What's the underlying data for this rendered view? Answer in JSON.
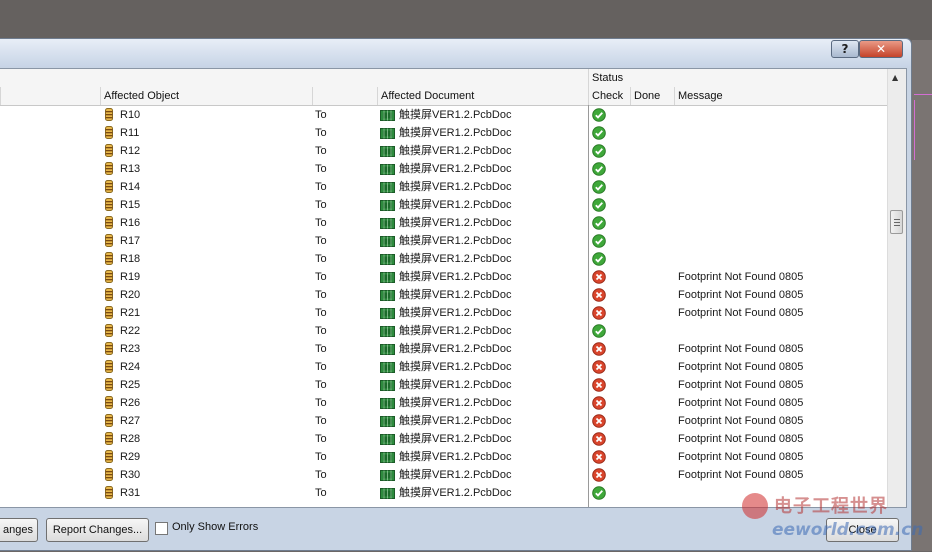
{
  "window": {
    "help_label": "?",
    "close_label": "✕"
  },
  "columns": {
    "status_group": "Status",
    "affected_object": "Affected Object",
    "affected_document": "Affected Document",
    "check": "Check",
    "done": "Done",
    "message": "Message"
  },
  "rows": [
    {
      "object": "R10",
      "to": "To",
      "document": "触摸屏VER1.2.PcbDoc",
      "check": "ok",
      "message": ""
    },
    {
      "object": "R11",
      "to": "To",
      "document": "触摸屏VER1.2.PcbDoc",
      "check": "ok",
      "message": ""
    },
    {
      "object": "R12",
      "to": "To",
      "document": "触摸屏VER1.2.PcbDoc",
      "check": "ok",
      "message": ""
    },
    {
      "object": "R13",
      "to": "To",
      "document": "触摸屏VER1.2.PcbDoc",
      "check": "ok",
      "message": ""
    },
    {
      "object": "R14",
      "to": "To",
      "document": "触摸屏VER1.2.PcbDoc",
      "check": "ok",
      "message": ""
    },
    {
      "object": "R15",
      "to": "To",
      "document": "触摸屏VER1.2.PcbDoc",
      "check": "ok",
      "message": ""
    },
    {
      "object": "R16",
      "to": "To",
      "document": "触摸屏VER1.2.PcbDoc",
      "check": "ok",
      "message": ""
    },
    {
      "object": "R17",
      "to": "To",
      "document": "触摸屏VER1.2.PcbDoc",
      "check": "ok",
      "message": ""
    },
    {
      "object": "R18",
      "to": "To",
      "document": "触摸屏VER1.2.PcbDoc",
      "check": "ok",
      "message": ""
    },
    {
      "object": "R19",
      "to": "To",
      "document": "触摸屏VER1.2.PcbDoc",
      "check": "error",
      "message": "Footprint Not Found 0805"
    },
    {
      "object": "R20",
      "to": "To",
      "document": "触摸屏VER1.2.PcbDoc",
      "check": "error",
      "message": "Footprint Not Found 0805"
    },
    {
      "object": "R21",
      "to": "To",
      "document": "触摸屏VER1.2.PcbDoc",
      "check": "error",
      "message": "Footprint Not Found 0805"
    },
    {
      "object": "R22",
      "to": "To",
      "document": "触摸屏VER1.2.PcbDoc",
      "check": "ok",
      "message": ""
    },
    {
      "object": "R23",
      "to": "To",
      "document": "触摸屏VER1.2.PcbDoc",
      "check": "error",
      "message": "Footprint Not Found 0805"
    },
    {
      "object": "R24",
      "to": "To",
      "document": "触摸屏VER1.2.PcbDoc",
      "check": "error",
      "message": "Footprint Not Found 0805"
    },
    {
      "object": "R25",
      "to": "To",
      "document": "触摸屏VER1.2.PcbDoc",
      "check": "error",
      "message": "Footprint Not Found 0805"
    },
    {
      "object": "R26",
      "to": "To",
      "document": "触摸屏VER1.2.PcbDoc",
      "check": "error",
      "message": "Footprint Not Found 0805"
    },
    {
      "object": "R27",
      "to": "To",
      "document": "触摸屏VER1.2.PcbDoc",
      "check": "error",
      "message": "Footprint Not Found 0805"
    },
    {
      "object": "R28",
      "to": "To",
      "document": "触摸屏VER1.2.PcbDoc",
      "check": "error",
      "message": "Footprint Not Found 0805"
    },
    {
      "object": "R29",
      "to": "To",
      "document": "触摸屏VER1.2.PcbDoc",
      "check": "error",
      "message": "Footprint Not Found 0805"
    },
    {
      "object": "R30",
      "to": "To",
      "document": "触摸屏VER1.2.PcbDoc",
      "check": "error",
      "message": "Footprint Not Found 0805"
    },
    {
      "object": "R31",
      "to": "To",
      "document": "触摸屏VER1.2.PcbDoc",
      "check": "ok",
      "message": ""
    }
  ],
  "footer": {
    "execute_label": "anges",
    "report_label": "Report Changes...",
    "only_errors_label": "Only Show Errors",
    "only_errors_checked": false,
    "close_label": "Close"
  },
  "watermark": {
    "cn": "电子工程世界",
    "en": "eeworld.com.cn"
  },
  "colors": {
    "ok": "#3fa83a",
    "error": "#d9452c"
  }
}
